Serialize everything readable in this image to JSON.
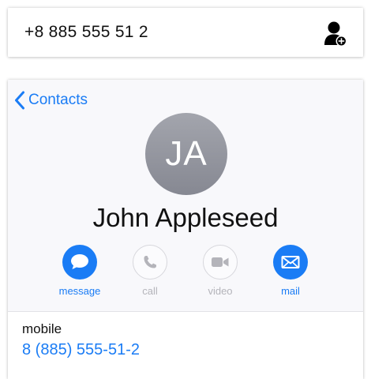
{
  "dialer": {
    "number": "+8 885 555 51 2",
    "add_contact_icon": "person-add-icon"
  },
  "contact": {
    "back_label": "Contacts",
    "initials": "JA",
    "name": "John Appleseed",
    "actions": [
      {
        "label": "message",
        "icon": "message-bubble-icon",
        "enabled": true
      },
      {
        "label": "call",
        "icon": "phone-icon",
        "enabled": false
      },
      {
        "label": "video",
        "icon": "video-camera-icon",
        "enabled": false
      },
      {
        "label": "mail",
        "icon": "envelope-icon",
        "enabled": true
      }
    ],
    "detail": {
      "label": "mobile",
      "value": "8 (885) 555-51-2"
    }
  },
  "colors": {
    "accent": "#1a7cf5",
    "disabled": "#b4b4ba",
    "avatar": "#8e9098"
  }
}
